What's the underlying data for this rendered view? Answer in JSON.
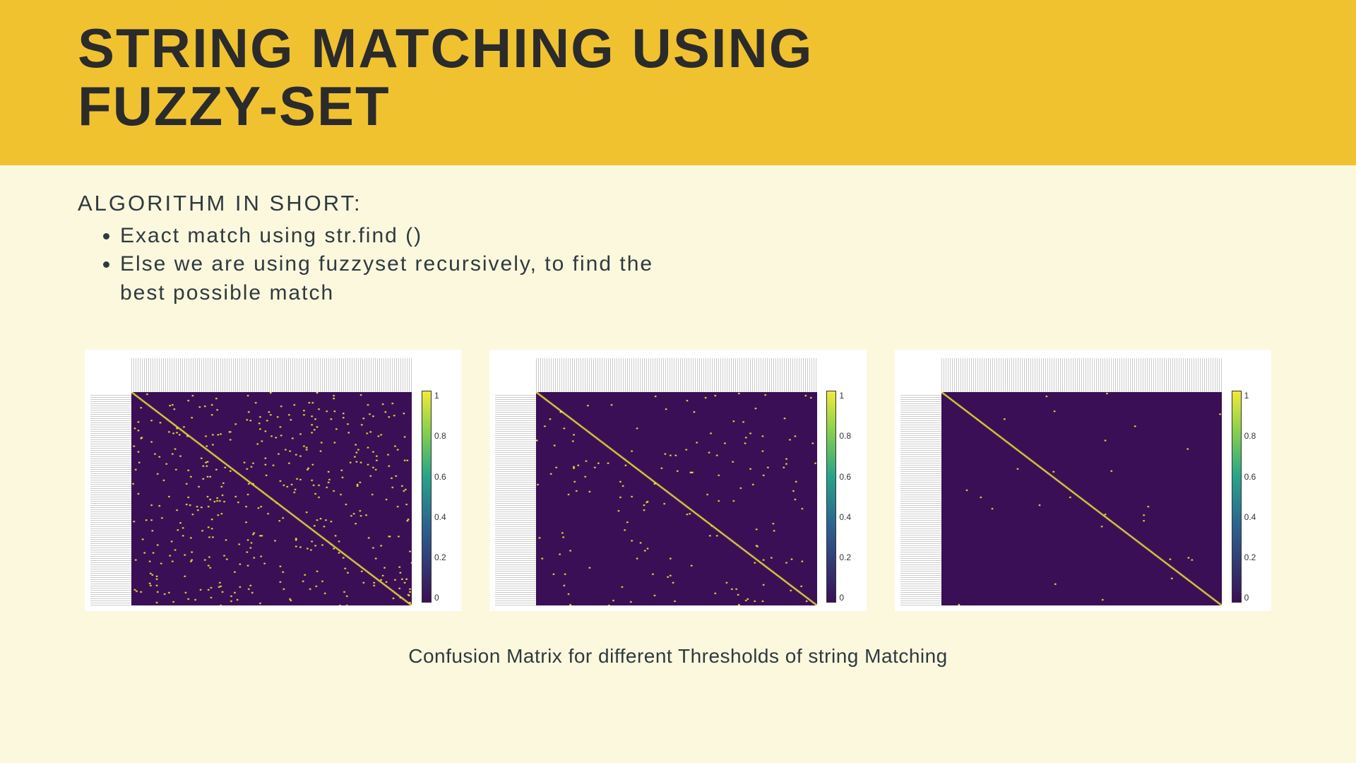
{
  "header": {
    "title_line1": "STRING MATCHING USING",
    "title_line2": "FUZZY-SET"
  },
  "algorithm": {
    "label": "ALGORITHM IN SHORT:",
    "bullets": [
      "Exact match using str.find ()",
      "Else we are using fuzzyset recursively, to find the best possible match"
    ]
  },
  "caption": "Confusion Matrix for different Thresholds of string Matching",
  "chart_data": [
    {
      "type": "heatmap",
      "title": "",
      "xlabel": "",
      "ylabel": "",
      "axis_note": "axes are category labels (many, unreadable at this resolution)",
      "colorbar_range": [
        0.0,
        1.0
      ],
      "colorbar_ticks": [
        1.0,
        0.8,
        0.6,
        0.4,
        0.2,
        0.0
      ],
      "description": "Confusion matrix at low threshold — strong yellow diagonal plus many scattered yellow off-diagonal points on deep-purple background",
      "noise_density": 0.22
    },
    {
      "type": "heatmap",
      "title": "",
      "xlabel": "",
      "ylabel": "",
      "axis_note": "axes are category labels (many, unreadable at this resolution)",
      "colorbar_range": [
        0.0,
        1.0
      ],
      "colorbar_ticks": [
        1.0,
        0.8,
        0.6,
        0.4,
        0.2,
        0.0
      ],
      "description": "Confusion matrix at medium threshold — clear yellow diagonal, moderate scattered off-diagonal points",
      "noise_density": 0.08
    },
    {
      "type": "heatmap",
      "title": "",
      "xlabel": "",
      "ylabel": "",
      "axis_note": "axes are category labels (many, unreadable at this resolution)",
      "colorbar_range": [
        0.0,
        1.0
      ],
      "colorbar_ticks": [
        1.0,
        0.8,
        0.6,
        0.4,
        0.2,
        0.0
      ],
      "description": "Confusion matrix at high threshold — sharp yellow diagonal, very few off-diagonal points",
      "noise_density": 0.015
    }
  ]
}
